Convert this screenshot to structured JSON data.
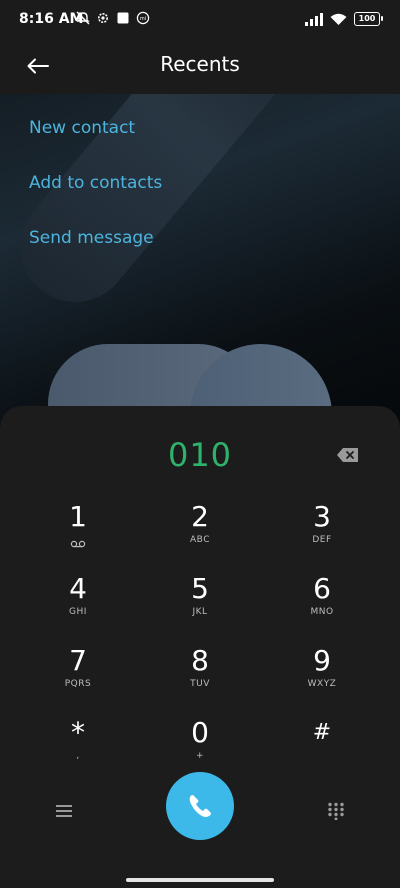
{
  "status_bar": {
    "time": "8:16 AM",
    "left_icons": [
      "mute-icon",
      "settings-icon",
      "square-icon",
      "mi-icon"
    ],
    "right_icons": [
      "signal-icon",
      "wifi-icon"
    ],
    "battery": "100"
  },
  "header": {
    "title": "Recents",
    "back_icon": "back-arrow-icon"
  },
  "actions": {
    "new_contact": "New contact",
    "add_to_contacts": "Add to contacts",
    "send_message": "Send message"
  },
  "dialer": {
    "number": "010",
    "backspace_icon": "backspace-icon",
    "keys": [
      {
        "digit": "1",
        "letters": "",
        "icon": "voicemail-icon"
      },
      {
        "digit": "2",
        "letters": "ABC"
      },
      {
        "digit": "3",
        "letters": "DEF"
      },
      {
        "digit": "4",
        "letters": "GHI"
      },
      {
        "digit": "5",
        "letters": "JKL"
      },
      {
        "digit": "6",
        "letters": "MNO"
      },
      {
        "digit": "7",
        "letters": "PQRS"
      },
      {
        "digit": "8",
        "letters": "TUV"
      },
      {
        "digit": "9",
        "letters": "WXYZ"
      },
      {
        "digit": "*",
        "letters": ","
      },
      {
        "digit": "0",
        "letters": "+"
      },
      {
        "digit": "#",
        "letters": ""
      }
    ],
    "menu_icon": "menu-icon",
    "call_icon": "phone-icon",
    "dialpad_icon": "dialpad-icon",
    "accent_color": "#3cb9e9",
    "number_color": "#2db36b",
    "link_color": "#4cb5df"
  }
}
